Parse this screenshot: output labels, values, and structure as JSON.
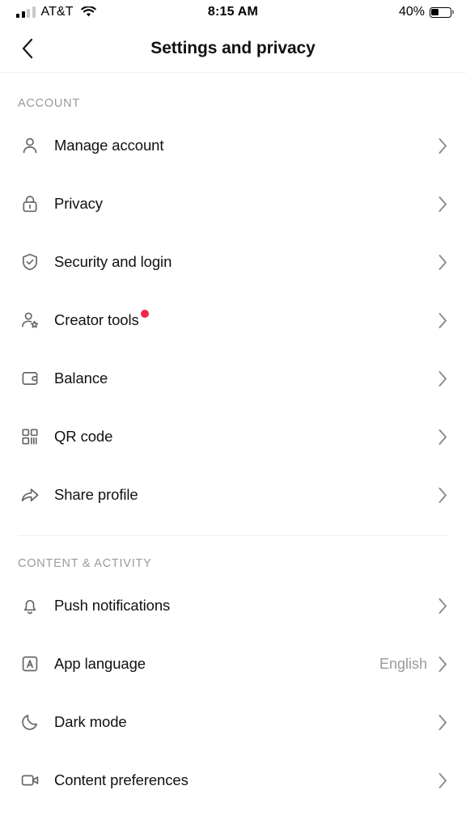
{
  "status_bar": {
    "carrier": "AT&T",
    "signal_icon": "cellular-bars-icon",
    "wifi_icon": "wifi-icon",
    "time": "8:15 AM",
    "battery_percent": "40%",
    "battery_level": 40,
    "battery_icon": "battery-icon"
  },
  "header": {
    "back_icon": "chevron-left-icon",
    "title": "Settings and privacy"
  },
  "sections": [
    {
      "title": "ACCOUNT",
      "items": [
        {
          "label": "Manage account",
          "icon": "person-icon",
          "value": "",
          "badge": false,
          "chevron": "chevron-right-icon"
        },
        {
          "label": "Privacy",
          "icon": "lock-icon",
          "value": "",
          "badge": false,
          "chevron": "chevron-right-icon"
        },
        {
          "label": "Security and login",
          "icon": "shield-check-icon",
          "value": "",
          "badge": false,
          "chevron": "chevron-right-icon"
        },
        {
          "label": "Creator tools",
          "icon": "person-star-icon",
          "value": "",
          "badge": true,
          "chevron": "chevron-right-icon"
        },
        {
          "label": "Balance",
          "icon": "wallet-icon",
          "value": "",
          "badge": false,
          "chevron": "chevron-right-icon"
        },
        {
          "label": "QR code",
          "icon": "qr-code-icon",
          "value": "",
          "badge": false,
          "chevron": "chevron-right-icon"
        },
        {
          "label": "Share profile",
          "icon": "share-arrow-icon",
          "value": "",
          "badge": false,
          "chevron": "chevron-right-icon"
        }
      ]
    },
    {
      "title": "CONTENT & ACTIVITY",
      "items": [
        {
          "label": "Push notifications",
          "icon": "bell-icon",
          "value": "",
          "badge": false,
          "chevron": "chevron-right-icon"
        },
        {
          "label": "App language",
          "icon": "language-a-icon",
          "value": "English",
          "badge": false,
          "chevron": "chevron-right-icon"
        },
        {
          "label": "Dark mode",
          "icon": "moon-icon",
          "value": "",
          "badge": false,
          "chevron": "chevron-right-icon"
        },
        {
          "label": "Content preferences",
          "icon": "video-camera-icon",
          "value": "",
          "badge": false,
          "chevron": "chevron-right-icon"
        }
      ]
    }
  ],
  "colors": {
    "badge_red": "#f0274b",
    "text_primary": "#111111",
    "text_muted": "#9a9a9d",
    "icon_gray": "#66676c",
    "divider": "#efefef",
    "background": "#ffffff"
  }
}
